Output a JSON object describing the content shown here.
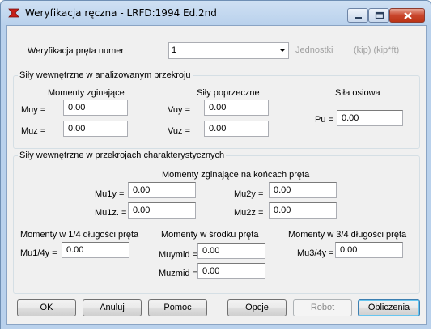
{
  "window": {
    "title": "Weryfikacja ręczna - LRFD:1994 Ed.2nd"
  },
  "member": {
    "label": "Weryfikacja pręta numer:",
    "selected": "1",
    "units_label": "Jednostki",
    "units_value": "(kip) (kip*ft)"
  },
  "analyzed": {
    "title": "Siły wewnętrzne w analizowanym przekroju",
    "moments_header": "Momenty zginające",
    "shear_header": "Siły poprzeczne",
    "axial_header": "Siła osiowa",
    "muy_label": "Muy =",
    "muy_value": "0.00",
    "muz_label": "Muz =",
    "muz_value": "0.00",
    "vuy_label": "Vuy =",
    "vuy_value": "0.00",
    "vuz_label": "Vuz =",
    "vuz_value": "0.00",
    "pu_label": "Pu =",
    "pu_value": "0.00"
  },
  "characteristic": {
    "title": "Siły wewnętrzne w przekrojach charakterystycznych",
    "ends_header": "Momenty zginające na końcach pręta",
    "mu1y_label": "Mu1y =",
    "mu1y_value": "0.00",
    "mu1z_label": "Mu1z. =",
    "mu1z_value": "0.00",
    "mu2y_label": "Mu2y =",
    "mu2y_value": "0.00",
    "mu2z_label": "Mu2z =",
    "mu2z_value": "0.00",
    "quarter_header": "Momenty w 1/4 długości pręta",
    "mu14y_label": "Mu1/4y =",
    "mu14y_value": "0.00",
    "mid_header": "Momenty w środku pręta",
    "muymid_label": "Muymid =",
    "muymid_value": "0.00",
    "muzmid_label": "Muzmid =",
    "muzmid_value": "0.00",
    "threequarter_header": "Momenty w 3/4 długości pręta",
    "mu34y_label": "Mu3/4y =",
    "mu34y_value": "0.00"
  },
  "buttons": {
    "ok": "OK",
    "cancel": "Anuluj",
    "help": "Pomoc",
    "options": "Opcje",
    "robot": "Robot",
    "calculations": "Obliczenia"
  },
  "colors": {
    "app_icon": "#c8201a",
    "close_button": "#c9452c"
  }
}
